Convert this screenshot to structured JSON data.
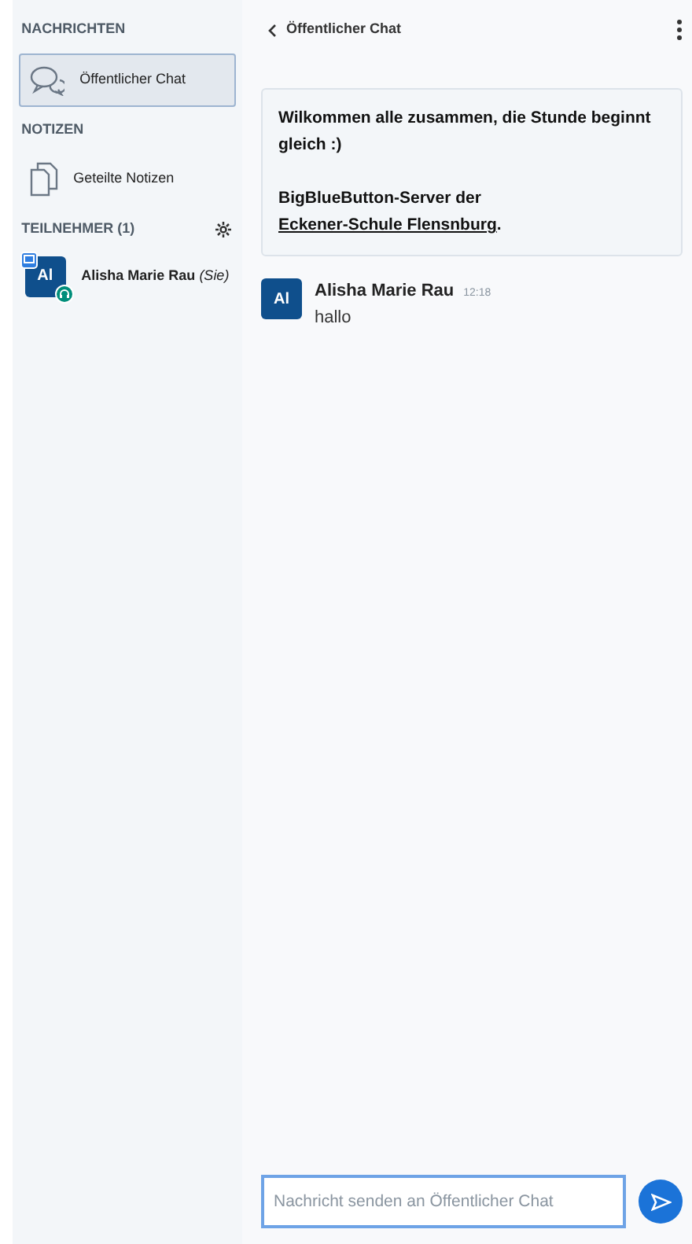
{
  "sidebar": {
    "sections": [
      {
        "title": "NACHRICHTEN",
        "items": [
          {
            "kind": "chat",
            "label": "Öffentlicher Chat",
            "selected": true
          }
        ]
      },
      {
        "title": "NOTIZEN",
        "items": [
          {
            "kind": "notes",
            "label": "Geteilte Notizen",
            "selected": false
          }
        ]
      }
    ],
    "participants": {
      "title": "TEILNEHMER (1)",
      "users": [
        {
          "initials": "Al",
          "name": "Alisha Marie Rau",
          "suffix": "(Sie)",
          "presenter": true,
          "audio": true
        }
      ]
    }
  },
  "chat": {
    "title": "Öffentlicher Chat",
    "welcome": {
      "line1": "Wilkommen alle zusammen, die Stunde beginnt gleich :)",
      "before": "BigBlueButton-Server der ",
      "link": "Eckener-Schule Flensnburg",
      "after": "."
    },
    "messages": [
      {
        "initials": "Al",
        "author": "Alisha Marie Rau",
        "time": "12:18",
        "text": "hallo"
      }
    ],
    "input": {
      "placeholder": "Nachricht senden an Öffentlicher Chat"
    }
  }
}
